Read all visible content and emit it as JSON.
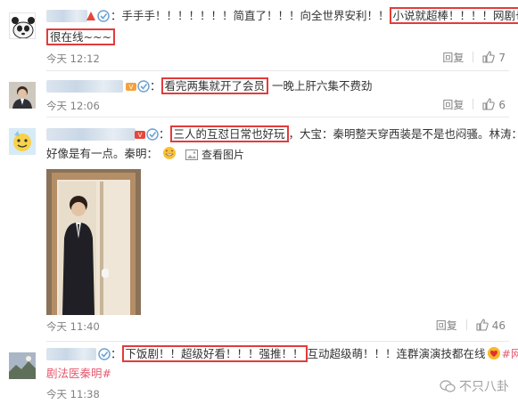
{
  "comments": [
    {
      "segments": [
        {
          "text": "：手手手！！！！！！！简直了！！！向全世界安利！！",
          "boxed": false
        },
        {
          "text": "小说就超棒！！！！网剧也",
          "boxed": true
        }
      ],
      "segments2": [
        {
          "text": "很在线~~~",
          "boxed": true
        }
      ],
      "time": "今天 12:12",
      "reply": "回复",
      "likes": "7"
    },
    {
      "segments": [
        {
          "text": "：",
          "boxed": false
        },
        {
          "text": "看完两集就开了会员",
          "boxed": true
        },
        {
          "text": "  一晚上肝六集不费劲",
          "boxed": false
        }
      ],
      "time": "今天 12:06",
      "reply": "回复",
      "likes": "6"
    },
    {
      "segments": [
        {
          "text": "：",
          "boxed": false
        },
        {
          "text": "三人的互怼日常也好玩",
          "boxed": true
        },
        {
          "text": "，大宝：秦明整天穿西装是不是也闷骚。林涛：",
          "boxed": false
        }
      ],
      "segments2": [
        {
          "text": "好像是有一点。秦明：",
          "boxed": false
        }
      ],
      "photo_link": "查看图片",
      "time": "今天 11:40",
      "reply": "回复",
      "likes": "46"
    },
    {
      "segments": [
        {
          "text": "：",
          "boxed": false
        },
        {
          "text": "下饭剧！！超级好看！！！强推！！",
          "boxed": true
        },
        {
          "text": "互动超级萌！！！连群演演技都在线",
          "boxed": false
        },
        {
          "text": "#网",
          "boxed": false,
          "link": true
        }
      ],
      "segments2": [
        {
          "text": "剧法医秦明#",
          "boxed": false,
          "link": true
        }
      ],
      "time": "今天 11:38"
    }
  ],
  "watermark": "不只八卦",
  "colors": {
    "accent": "#e45a6f",
    "box": "#e33b3b",
    "meta": "#808080"
  },
  "icons": {
    "verify": "verified-badge-icon",
    "like": "thumbs-up-icon",
    "photo": "picture-icon",
    "emoji": "grin-emoji-icon",
    "heart": "heart-emoji-icon",
    "wechat": "wechat-logo-icon"
  }
}
